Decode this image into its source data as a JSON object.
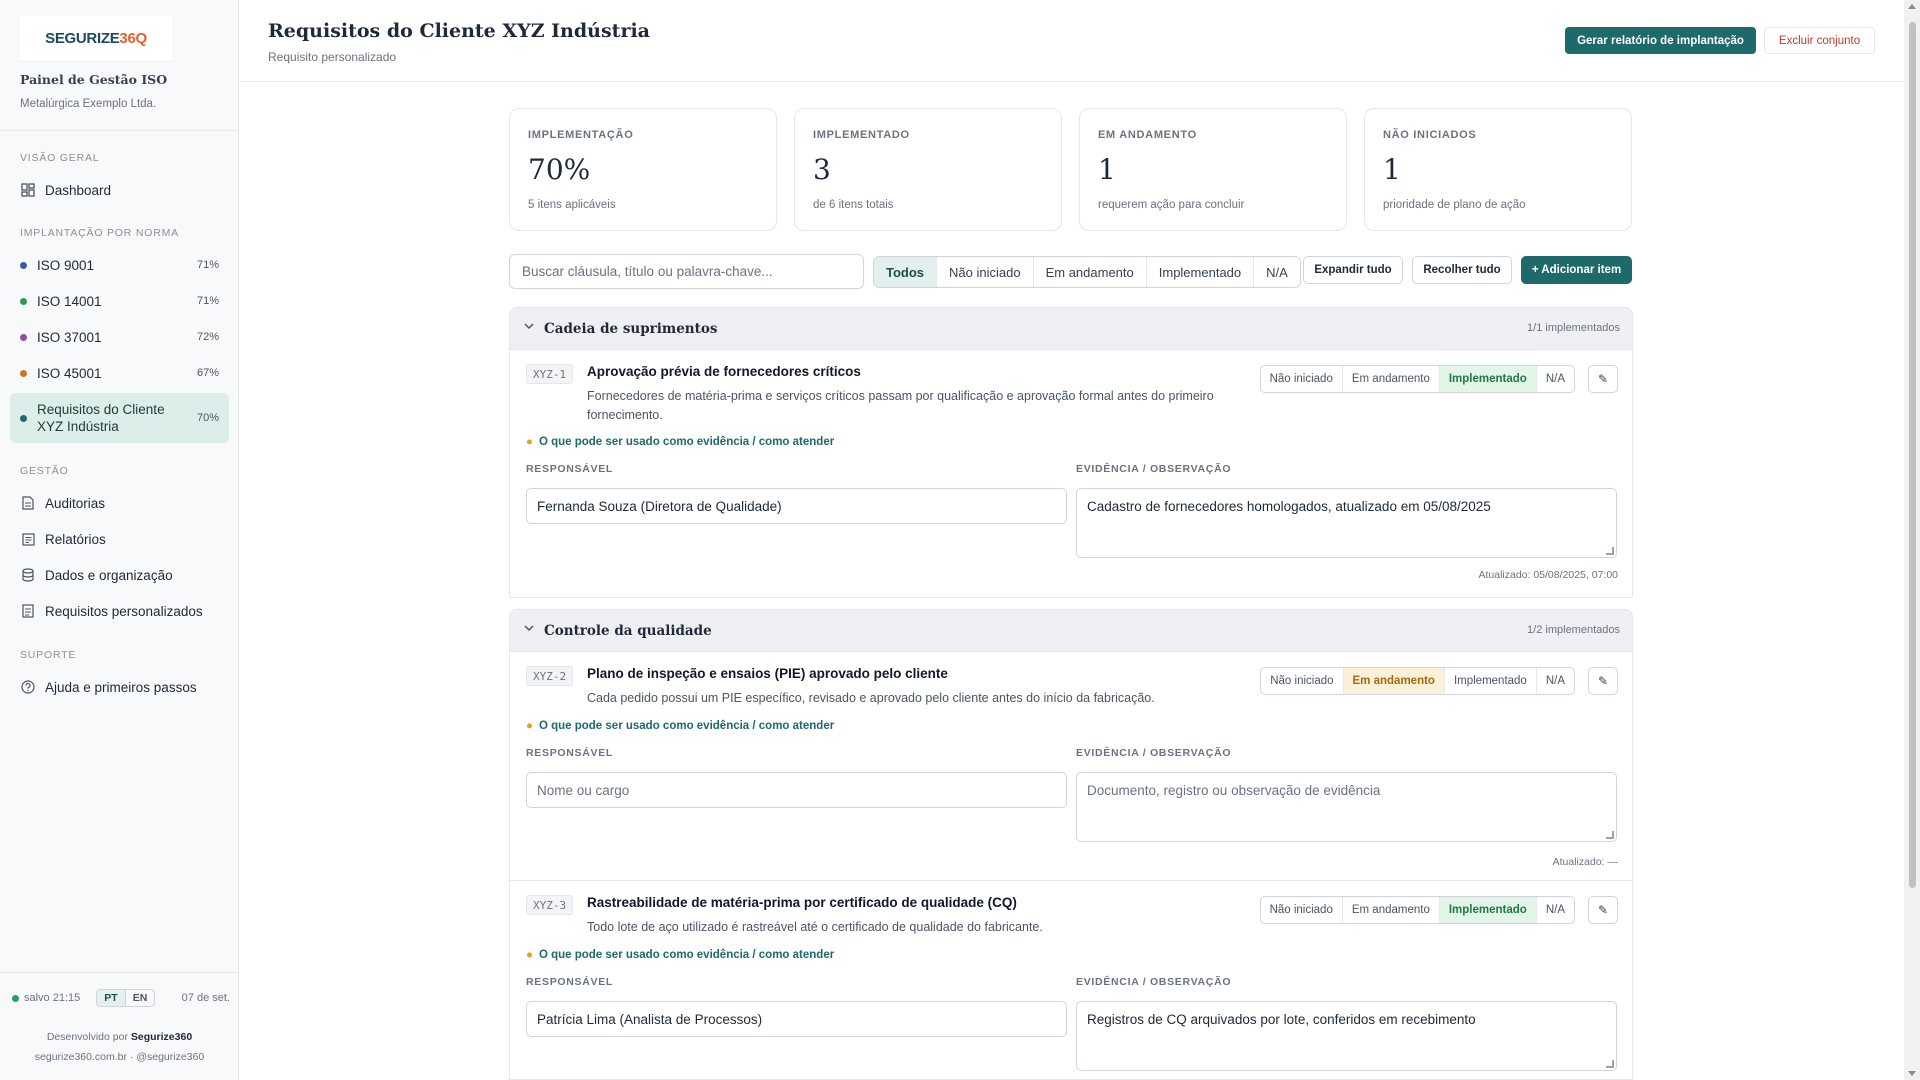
{
  "sidebar": {
    "brand_a": "SEGURIZE",
    "brand_b": "36Q",
    "panel_title": "Painel de Gestão ISO",
    "panel_sub": "Metalúrgica Exemplo Ltda.",
    "sec_overview": "VISÃO GERAL",
    "dashboard": "Dashboard",
    "sec_impl": "IMPLANTAÇÃO POR NORMA",
    "norms": [
      {
        "label": "ISO 9001",
        "pct": "71%",
        "color": "#3b5ba5"
      },
      {
        "label": "ISO 14001",
        "pct": "71%",
        "color": "#2e9b55"
      },
      {
        "label": "ISO 37001",
        "pct": "72%",
        "color": "#8b4fb3"
      },
      {
        "label": "ISO 45001",
        "pct": "67%",
        "color": "#c97a1e"
      },
      {
        "label": "Requisitos do Cliente XYZ Indústria",
        "pct": "70%",
        "color": "#1e6a6a"
      }
    ],
    "sec_gestao": "GESTÃO",
    "gestao": [
      "Auditorias",
      "Relatórios",
      "Dados e organização",
      "Requisitos personalizados"
    ],
    "sec_suporte": "SUPORTE",
    "help": "Ajuda e primeiros passos",
    "saved": "salvo 21:15",
    "lang_pt": "PT",
    "lang_en": "EN",
    "date": "07 de set.",
    "dev_by": "Desenvolvido por",
    "dev_name": "Segurize360",
    "site": "segurize360.com.br  ·  @segurize360"
  },
  "header": {
    "title": "Requisitos do Cliente XYZ Indústria",
    "subtitle": "Requisito personalizado",
    "gen_report": "Gerar relatório de implantação",
    "delete": "Excluir conjunto"
  },
  "stats": [
    {
      "label": "IMPLEMENTAÇÃO",
      "value": "70%",
      "sub": "5 itens aplicáveis"
    },
    {
      "label": "IMPLEMENTADO",
      "value": "3",
      "sub": "de 6 itens totais"
    },
    {
      "label": "EM ANDAMENTO",
      "value": "1",
      "sub": "requerem ação para concluir"
    },
    {
      "label": "NÃO INICIADOS",
      "value": "1",
      "sub": "prioridade de plano de ação"
    }
  ],
  "toolbar": {
    "search_placeholder": "Buscar cláusula, título ou palavra-chave...",
    "filters": [
      "Todos",
      "Não iniciado",
      "Em andamento",
      "Implementado",
      "N/A"
    ],
    "expand": "Expandir tudo",
    "collapse": "Recolher tudo",
    "add": "+ Adicionar item"
  },
  "status_labels": [
    "Não iniciado",
    "Em andamento",
    "Implementado",
    "N/A"
  ],
  "labels": {
    "hint": "O que pode ser usado como evidência / como atender",
    "responsible": "RESPONSÁVEL",
    "evidence": "EVIDÊNCIA / OBSERVAÇÃO",
    "resp_placeholder": "Nome ou cargo",
    "ev_placeholder": "Documento, registro ou observação de evidência"
  },
  "groups": [
    {
      "title": "Cadeia de suprimentos",
      "count": "1/1 implementados"
    },
    {
      "title": "Controle da qualidade",
      "count": "1/2 implementados"
    }
  ],
  "items": [
    {
      "code": "XYZ-1",
      "title": "Aprovação prévia de fornecedores críticos",
      "desc": "Fornecedores de matéria-prima e serviços críticos passam por qualificação e aprovação formal antes do primeiro fornecimento.",
      "status": "Implementado",
      "responsible": "Fernanda Souza (Diretora de Qualidade)",
      "evidence": "Cadastro de fornecedores homologados, atualizado em 05/08/2025",
      "updated": "Atualizado: 05/08/2025, 07:00"
    },
    {
      "code": "XYZ-2",
      "title": "Plano de inspeção e ensaios (PIE) aprovado pelo cliente",
      "desc": "Cada pedido possui um PIE específico, revisado e aprovado pelo cliente antes do início da fabricação.",
      "status": "Em andamento",
      "responsible": "",
      "evidence": "",
      "updated": "Atualizado: —"
    },
    {
      "code": "XYZ-3",
      "title": "Rastreabilidade de matéria-prima por certificado de qualidade (CQ)",
      "desc": "Todo lote de aço utilizado é rastreável até o certificado de qualidade do fabricante.",
      "status": "Implementado",
      "responsible": "Patrícia Lima (Analista de Processos)",
      "evidence": "Registros de CQ arquivados por lote, conferidos em recebimento",
      "updated": ""
    }
  ]
}
